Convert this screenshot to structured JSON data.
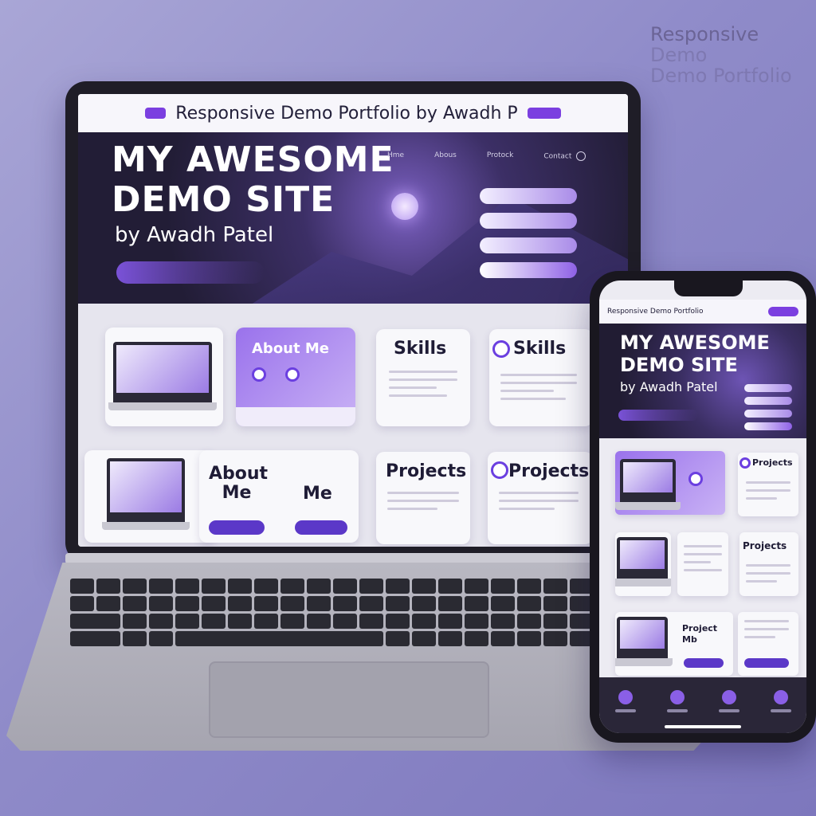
{
  "watermark": {
    "line1": "Responsive",
    "line2": "Demo",
    "line3": "Demo Portfolio"
  },
  "laptop": {
    "title_bar": {
      "title": "Responsive Demo Portfolio  by Awadh P"
    },
    "hero": {
      "title_line1": "MY AWESOME",
      "title_line2": "DEMO SITE",
      "subtitle": "by Awadh Patel",
      "nav": [
        "Hme",
        "Abous",
        "Protock",
        "Contact"
      ]
    },
    "cards": {
      "about_me_1": "About Me",
      "skills_1": "Skills",
      "skills_2": "Skills",
      "about_me_2": "About Me",
      "me": "Me",
      "projects_1": "Projects",
      "projects_2": "Projects"
    }
  },
  "phone": {
    "title_bar": {
      "title": "Responsive Demo Portfolio"
    },
    "hero": {
      "title_line1": "MY AWESOME",
      "title_line2": "DEMO SITE",
      "subtitle": "by Awadh Patel"
    },
    "cards": {
      "projects_a": "Projects",
      "projects_b": "Projects",
      "project_mb": "Project Mb"
    }
  },
  "colors": {
    "accent": "#7b3fe0",
    "hero_dark": "#221d36",
    "background": "#8f8bc9"
  }
}
